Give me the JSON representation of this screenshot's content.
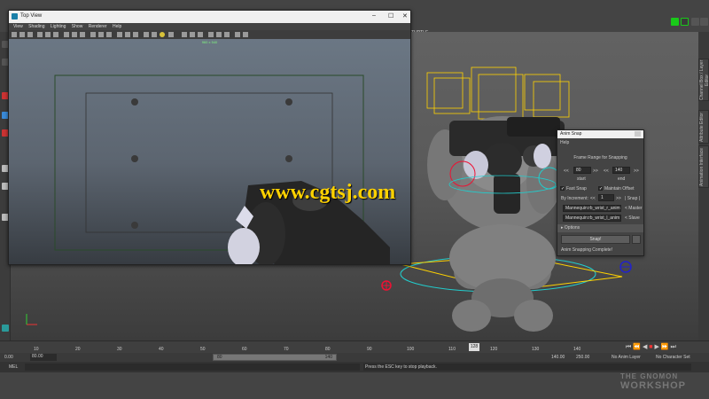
{
  "top_view": {
    "title": "Top View",
    "menus": [
      "View",
      "Shading",
      "Lighting",
      "Show",
      "Renderer",
      "Help"
    ],
    "resolution": "960 x 540"
  },
  "main_shelf": {
    "turtle_tab": "TURTLE"
  },
  "watermark": "www.cgtsj.com",
  "anim_snap": {
    "title": "Anim Snap",
    "menu_help": "Help",
    "frame_range_label": "Frame Range for Snapping",
    "start_value": "80",
    "end_value": "140",
    "start_label": "start",
    "end_label": "end",
    "prev_btn": "<<",
    "next_btn": ">>",
    "fast_snap_label": "Fast Snap",
    "maintain_offset_label": "Maintain Offset",
    "by_increment_label": "By Increment:",
    "increment_value": "1",
    "snap_bracket_label": "| Snap |",
    "master_field": "Mannequin:rb_wrist_r_anim",
    "master_btn": "< Master",
    "slave_field": "Mannequin:rb_wrist_l_anim",
    "slave_btn": "< Slave",
    "options_label": "Options",
    "snap_btn": "Snap!",
    "status": "Anim Snapping Complete!"
  },
  "right_tabs": [
    "Channel Box / Layer Editor",
    "Attribute Editor",
    "Animation Interface"
  ],
  "timeline": {
    "ticks": [
      "10",
      "20",
      "30",
      "40",
      "50",
      "60",
      "70",
      "80",
      "90",
      "100",
      "110",
      "120",
      "130",
      "140"
    ],
    "current_frame": "128"
  },
  "range": {
    "start_outer": "0.00",
    "start_inner": "80.00",
    "slider_left": "80",
    "slider_right": "140",
    "end_inner": "140.00",
    "end_outer": "250.00",
    "anim_layer": "No Anim Layer",
    "char_set": "No Character Set"
  },
  "command_line": {
    "mel_label": "MEL",
    "help_text": "Press the ESC key to stop playback."
  },
  "branding": {
    "line1": "THE GNOMON",
    "line2": "WORKSHOP"
  },
  "colors": {
    "accent_green": "#19c919",
    "highlight_cyan": "#2cc",
    "yellow": "#ffd200"
  }
}
